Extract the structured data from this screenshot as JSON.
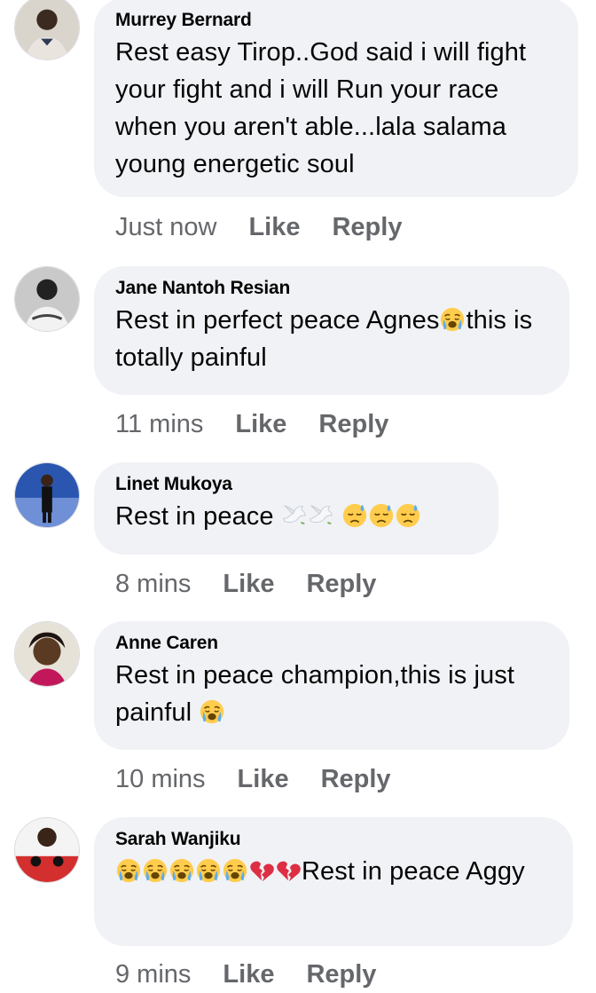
{
  "comments": [
    {
      "author": "Murrey Bernard",
      "text": "Rest easy Tirop..God said i will fight your fight and i will Run your race when you aren't able...lala salama young energetic soul",
      "time": "Just now",
      "like_label": "Like",
      "reply_label": "Reply"
    },
    {
      "author": "Jane Nantoh Resian",
      "text_parts": [
        "Rest in perfect peace Agnes",
        "this is totally painful"
      ],
      "emoji": [
        "loudly-crying-face"
      ],
      "time": "11 mins",
      "like_label": "Like",
      "reply_label": "Reply"
    },
    {
      "author": "Linet Mukoya",
      "text": "Rest in peace",
      "emoji": [
        "dove",
        "dove",
        "downcast-sweat-face",
        "downcast-sweat-face",
        "downcast-sweat-face"
      ],
      "time": "8 mins",
      "like_label": "Like",
      "reply_label": "Reply"
    },
    {
      "author": "Anne Caren",
      "text": "Rest in peace champion,this is just painful",
      "emoji": [
        "loudly-crying-face"
      ],
      "time": "10 mins",
      "like_label": "Like",
      "reply_label": "Reply"
    },
    {
      "author": "Sarah Wanjiku",
      "text": "Rest in peace Aggy",
      "emoji": [
        "loudly-crying-face",
        "loudly-crying-face",
        "loudly-crying-face",
        "loudly-crying-face",
        "loudly-crying-face",
        "broken-heart",
        "broken-heart"
      ],
      "time": "9 mins",
      "like_label": "Like",
      "reply_label": "Reply"
    }
  ],
  "colors": {
    "bubble": "#f0f2f5",
    "meta_text": "#65676b",
    "text": "#050505"
  }
}
